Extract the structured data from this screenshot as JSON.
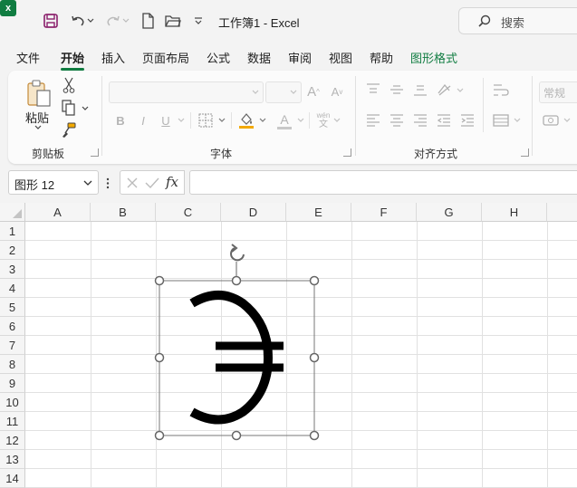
{
  "titlebar": {
    "title": "工作簿1  -  Excel",
    "search_placeholder": "搜索"
  },
  "menu": {
    "items": [
      "文件",
      "开始",
      "插入",
      "页面布局",
      "公式",
      "数据",
      "审阅",
      "视图",
      "帮助",
      "图形格式"
    ],
    "active": "开始"
  },
  "ribbon": {
    "clipboard": {
      "paste_label": "粘贴",
      "group_label": "剪贴板"
    },
    "font": {
      "group_label": "字体",
      "bold": "B",
      "italic": "I",
      "underline": "U",
      "grow": "A",
      "shrink": "A",
      "font_color_letter": "A",
      "phonetic_top": "wén",
      "phonetic_bottom": "文"
    },
    "alignment": {
      "group_label": "对齐方式"
    },
    "number": {
      "format_value": "常规"
    },
    "colors": {
      "fill_color": "#f2a900",
      "font_color": "#d83b01",
      "accent": "#107c41"
    }
  },
  "formula_bar": {
    "name_box_value": "图形 12",
    "fx_label": "fx",
    "formula_value": ""
  },
  "sheet": {
    "columns": [
      "A",
      "B",
      "C",
      "D",
      "E",
      "F",
      "G",
      "H"
    ],
    "rows": [
      "1",
      "2",
      "3",
      "4",
      "5",
      "6",
      "7",
      "8",
      "9",
      "10",
      "11",
      "12",
      "13",
      "14"
    ]
  },
  "shape": {
    "glyph_name": "contains-as-member-symbol",
    "selected": true
  }
}
